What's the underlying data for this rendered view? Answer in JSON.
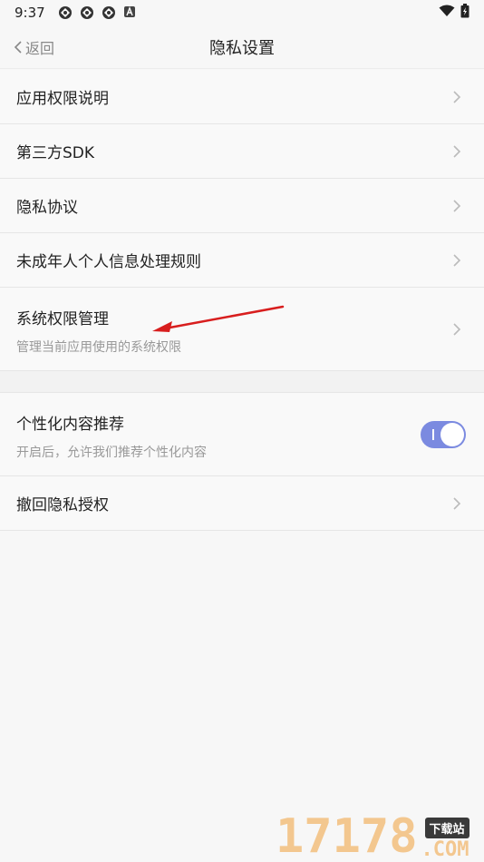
{
  "status_bar": {
    "time": "9:37",
    "icons": [
      "app-notification-icon",
      "app-notification-icon",
      "app-notification-icon",
      "a-badge-icon",
      "wifi-icon",
      "battery-icon"
    ]
  },
  "header": {
    "back_label": "返回",
    "title": "隐私设置"
  },
  "section1": {
    "items": [
      {
        "label": "应用权限说明"
      },
      {
        "label": "第三方SDK"
      },
      {
        "label": "隐私协议"
      },
      {
        "label": "未成年人个人信息处理规则"
      },
      {
        "label": "系统权限管理",
        "subtitle": "管理当前应用使用的系统权限"
      }
    ]
  },
  "section2": {
    "personalized": {
      "label": "个性化内容推荐",
      "subtitle": "开启后，允许我们推荐个性化内容",
      "enabled": true
    },
    "revoke": {
      "label": "撤回隐私授权"
    }
  },
  "watermark": {
    "number": "17178",
    "tag": "下载站",
    "domain": ".COM"
  },
  "colors": {
    "toggle_on": "#7b8ae0",
    "annotation_arrow": "#d81e1e"
  }
}
